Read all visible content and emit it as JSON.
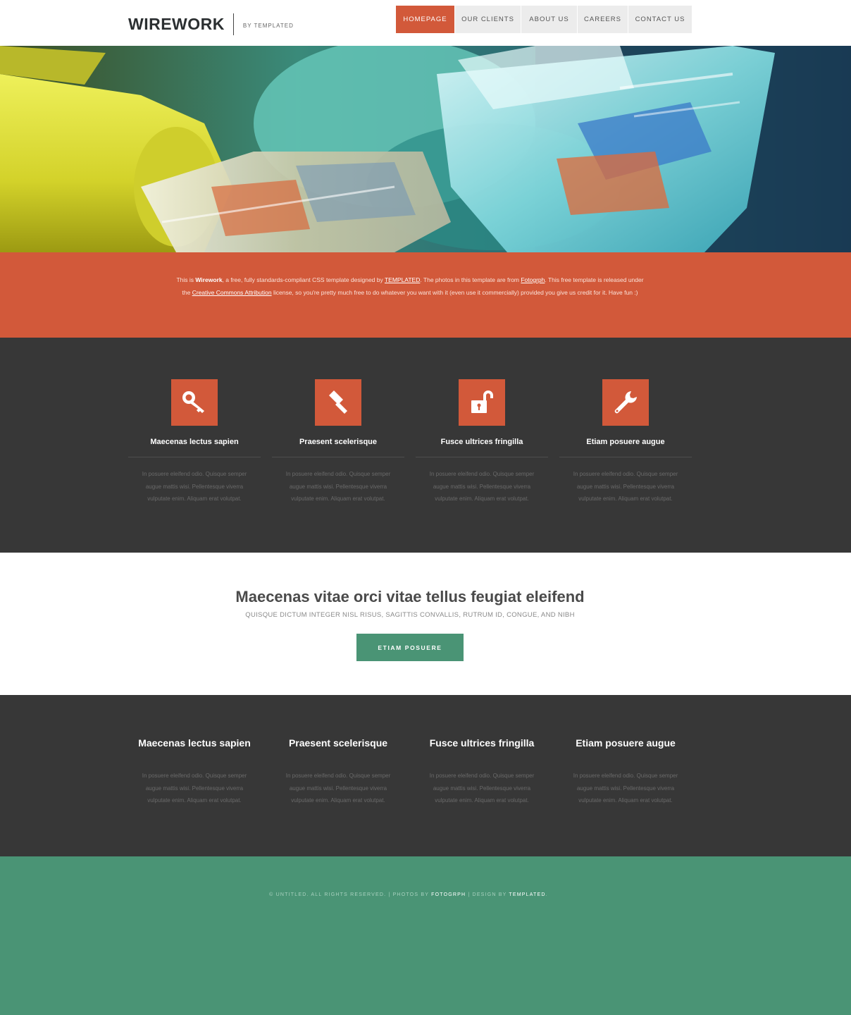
{
  "header": {
    "logo": "WIREWORK",
    "logo_sub": "BY TEMPLATED",
    "nav": [
      {
        "label": "HOMEPAGE",
        "active": true
      },
      {
        "label": "OUR CLIENTS",
        "active": false
      },
      {
        "label": "ABOUT US",
        "active": false
      },
      {
        "label": "CAREERS",
        "active": false
      },
      {
        "label": "CONTACT US",
        "active": false
      }
    ]
  },
  "intro": {
    "p1": "This is ",
    "brand": "Wirework",
    "p2": ", a free, fully standards-compliant CSS template designed by ",
    "link1": "TEMPLATED",
    "p3": ". The photos in this template are from ",
    "link2": "Fotogrph",
    "p4": ". This free template is released under the ",
    "link3": "Creative Commons Attribution",
    "p5": " license, so you're pretty much free to do whatever you want with it (even use it commercially) provided you give us credit for it. Have fun :)"
  },
  "features": [
    {
      "icon": "key-icon",
      "title": "Maecenas lectus sapien",
      "text": "In posuere eleifend odio. Quisque semper augue mattis wisi. Pellentesque viverra vulputate enim. Aliquam erat volutpat."
    },
    {
      "icon": "gavel-icon",
      "title": "Praesent scelerisque",
      "text": "In posuere eleifend odio. Quisque semper augue mattis wisi. Pellentesque viverra vulputate enim. Aliquam erat volutpat."
    },
    {
      "icon": "unlock-icon",
      "title": "Fusce ultrices fringilla",
      "text": "In posuere eleifend odio. Quisque semper augue mattis wisi. Pellentesque viverra vulputate enim. Aliquam erat volutpat."
    },
    {
      "icon": "wrench-icon",
      "title": "Etiam posuere augue",
      "text": "In posuere eleifend odio. Quisque semper augue mattis wisi. Pellentesque viverra vulputate enim. Aliquam erat volutpat."
    }
  ],
  "cta": {
    "title": "Maecenas vitae orci vitae tellus feugiat eleifend",
    "subtitle": "QUISQUE DICTUM INTEGER NISL RISUS, SAGITTIS CONVALLIS, RUTRUM ID, CONGUE, AND NIBH",
    "button": "ETIAM POSUERE"
  },
  "columns": [
    {
      "title": "Maecenas lectus sapien",
      "text": "In posuere eleifend odio. Quisque semper augue mattis wisi. Pellentesque viverra vulputate enim. Aliquam erat volutpat."
    },
    {
      "title": "Praesent scelerisque",
      "text": "In posuere eleifend odio. Quisque semper augue mattis wisi. Pellentesque viverra vulputate enim. Aliquam erat volutpat."
    },
    {
      "title": "Fusce ultrices fringilla",
      "text": "In posuere eleifend odio. Quisque semper augue mattis wisi. Pellentesque viverra vulputate enim. Aliquam erat volutpat."
    },
    {
      "title": "Etiam posuere augue",
      "text": "In posuere eleifend odio. Quisque semper augue mattis wisi. Pellentesque viverra vulputate enim. Aliquam erat volutpat."
    }
  ],
  "footer": {
    "copy1": "© UNTITLED. ALL RIGHTS RESERVED. | PHOTOS BY ",
    "link1": "FOTOGRPH",
    "copy2": " | DESIGN BY ",
    "link2": "TEMPLATED",
    "copy3": "."
  },
  "colors": {
    "accent": "#d2593a",
    "green": "#4a9475",
    "dark": "#373737"
  }
}
